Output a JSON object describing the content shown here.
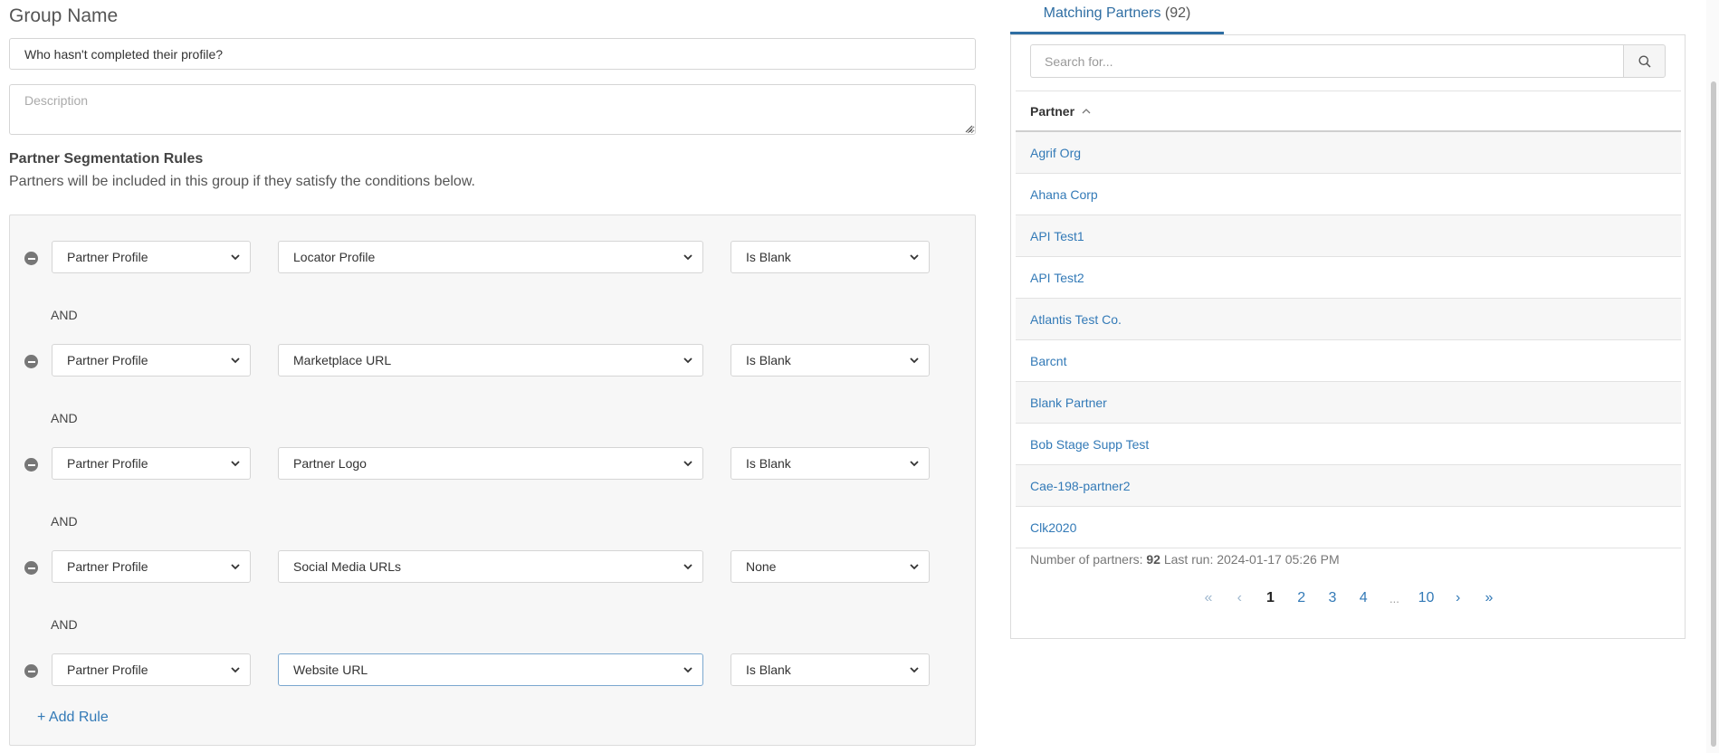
{
  "form": {
    "group_name_label": "Group Name",
    "group_name_value": "Who hasn't completed their profile?",
    "description_placeholder": "Description",
    "rules_title": "Partner Segmentation Rules",
    "rules_subtitle": "Partners will be included in this group if they satisfy the conditions below.",
    "and_label": "AND",
    "add_rule_label": "+ Add Rule",
    "rules": [
      {
        "source": "Partner Profile",
        "field": "Locator Profile",
        "condition": "Is Blank"
      },
      {
        "source": "Partner Profile",
        "field": "Marketplace URL",
        "condition": "Is Blank"
      },
      {
        "source": "Partner Profile",
        "field": "Partner Logo",
        "condition": "Is Blank"
      },
      {
        "source": "Partner Profile",
        "field": "Social Media URLs",
        "condition": "None"
      },
      {
        "source": "Partner Profile",
        "field": "Website URL",
        "condition": "Is Blank"
      }
    ]
  },
  "partners_panel": {
    "tab_label": "Matching Partners",
    "tab_count": "(92)",
    "search_placeholder": "Search for...",
    "column_header": "Partner",
    "rows": [
      "Agrif Org",
      "Ahana Corp",
      "API Test1",
      "API Test2",
      "Atlantis Test Co.",
      "Barcnt",
      "Blank Partner",
      "Bob Stage Supp Test",
      "Cae-198-partner2",
      "Clk2020"
    ],
    "count_label": "Number of partners:",
    "count_value": "92",
    "last_run_label": "Last run:",
    "last_run_value": "2024-01-17 05:26 PM",
    "pagination": {
      "first": "«",
      "prev": "‹",
      "pages": [
        "1",
        "2",
        "3",
        "4"
      ],
      "ellipsis": "...",
      "last_page": "10",
      "next": "›",
      "last": "»",
      "current": "1"
    }
  },
  "colors": {
    "link": "#337ab7",
    "tab_accent": "#2f6ea3"
  }
}
